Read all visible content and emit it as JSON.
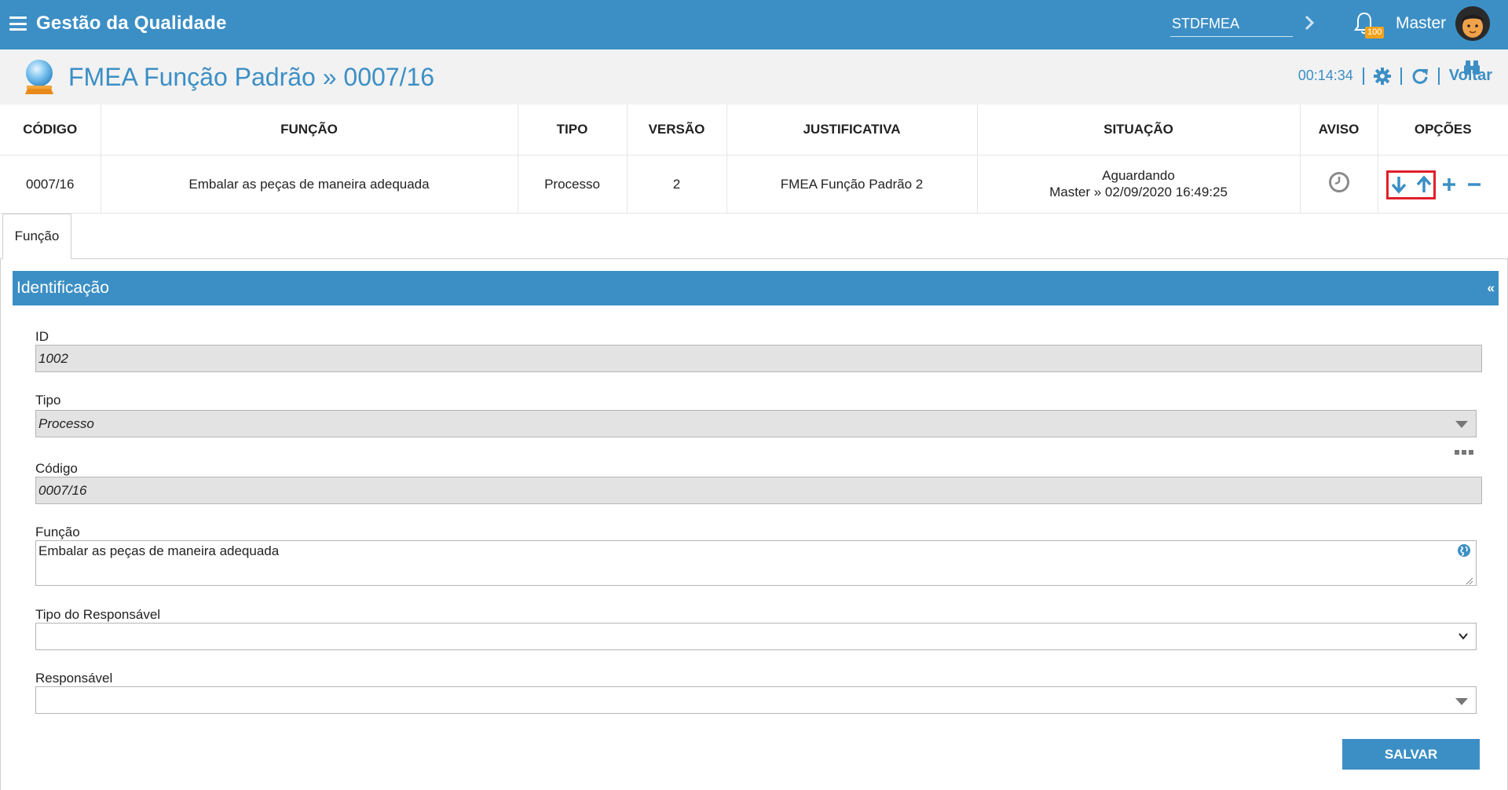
{
  "topbar": {
    "app_title": "Gestão da Qualidade",
    "module_value": "STDFMEA",
    "notification_count": "100",
    "user_name": "Master"
  },
  "header": {
    "title": "FMEA Função Padrão » 0007/16",
    "timer": "00:14:34",
    "back_label": "Voltar"
  },
  "record_table": {
    "headers": [
      "CÓDIGO",
      "FUNÇÃO",
      "TIPO",
      "VERSÃO",
      "JUSTIFICATIVA",
      "SITUAÇÃO",
      "AVISO",
      "OPÇÕES"
    ],
    "row": {
      "codigo": "0007/16",
      "funcao": "Embalar as peças de maneira adequada",
      "tipo": "Processo",
      "versao": "2",
      "justificativa": "FMEA Função Padrão 2",
      "situacao_status": "Aguardando",
      "situacao_detail": "Master » 02/09/2020 16:49:25"
    }
  },
  "tabs": [
    {
      "label": "Função"
    }
  ],
  "panel": {
    "title": "Identificação",
    "collapse_label": "«",
    "fields": {
      "id_label": "ID",
      "id_value": "1002",
      "tipo_label": "Tipo",
      "tipo_value": "Processo",
      "codigo_label": "Código",
      "codigo_value": "0007/16",
      "funcao_label": "Função",
      "funcao_value": "Embalar as peças de maneira adequada",
      "tipo_resp_label": "Tipo do Responsável",
      "tipo_resp_value": "",
      "resp_label": "Responsável",
      "resp_value": ""
    },
    "save_label": "SALVAR"
  },
  "colors": {
    "primary": "#3c8fc5",
    "highlight": "#e0202a",
    "badge": "#f4a21a"
  },
  "icons": [
    "menu-icon",
    "chevron-right-icon",
    "bell-icon",
    "avatar",
    "crystal-ball-icon",
    "gear-icon",
    "refresh-icon",
    "clock-icon",
    "arrow-down-icon",
    "arrow-up-icon",
    "plus-icon",
    "minus-icon",
    "binoculars-icon",
    "more-dots-icon",
    "globe-icon"
  ]
}
